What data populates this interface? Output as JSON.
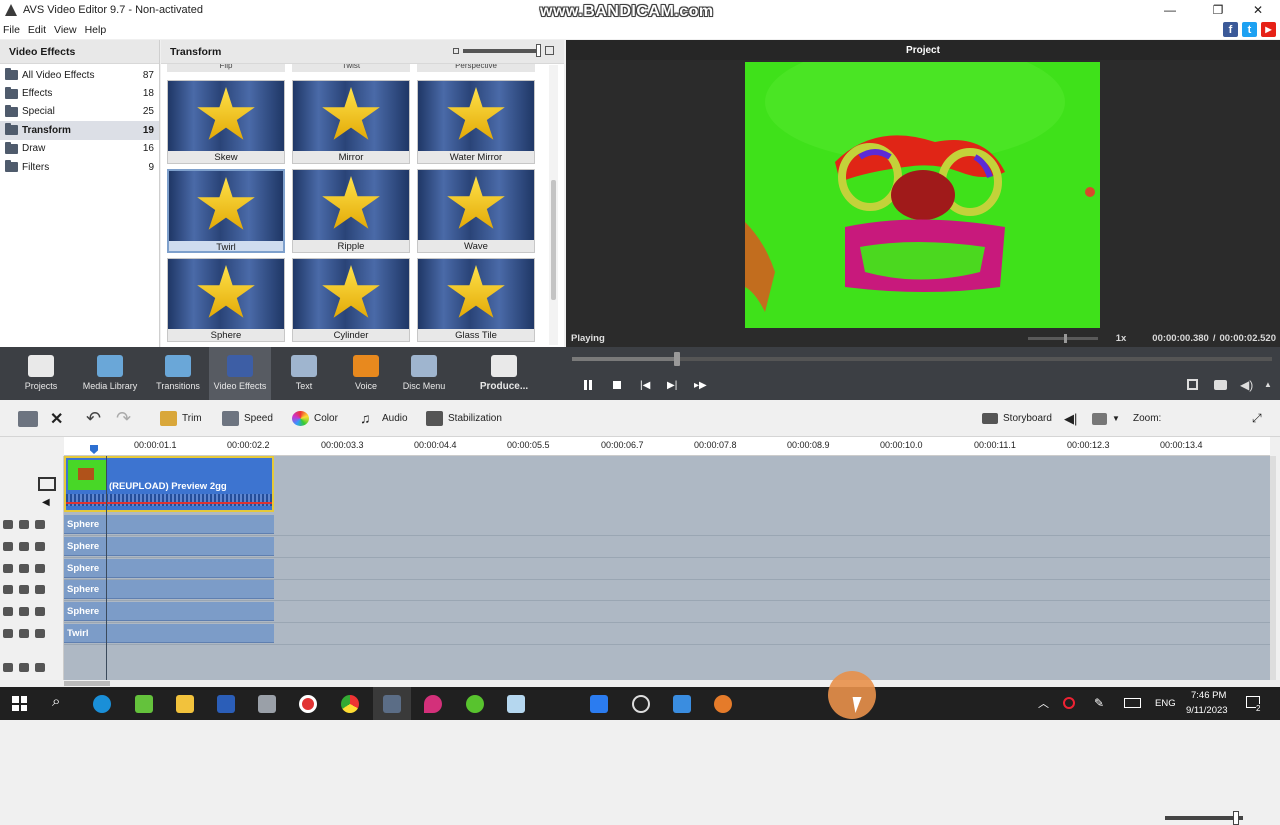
{
  "window": {
    "title": "AVS Video Editor 9.7 - Non-activated",
    "watermark": "www.BANDICAM.com",
    "controls": [
      "—",
      "❐",
      "✕"
    ]
  },
  "menu": [
    "File",
    "Edit",
    "View",
    "Help"
  ],
  "social": [
    {
      "label": "f",
      "color": "#3b5998"
    },
    {
      "label": "t",
      "color": "#1da1f2"
    },
    {
      "label": "▶",
      "color": "#e62117"
    }
  ],
  "categories": {
    "header": "Video Effects",
    "items": [
      {
        "label": "All Video Effects",
        "count": "87"
      },
      {
        "label": "Effects",
        "count": "18"
      },
      {
        "label": "Special",
        "count": "25"
      },
      {
        "label": "Transform",
        "count": "19"
      },
      {
        "label": "Draw",
        "count": "16"
      },
      {
        "label": "Filters",
        "count": "9"
      }
    ]
  },
  "effects": {
    "header": "Transform",
    "top_partial": [
      "Flip",
      "Twist",
      "Perspective"
    ],
    "items": [
      {
        "label": "Skew"
      },
      {
        "label": "Mirror"
      },
      {
        "label": "Water Mirror"
      },
      {
        "label": "Twirl"
      },
      {
        "label": "Ripple"
      },
      {
        "label": "Wave"
      },
      {
        "label": "Sphere"
      },
      {
        "label": "Cylinder"
      },
      {
        "label": "Glass Tile"
      }
    ]
  },
  "preview": {
    "header": "Project",
    "status": "Playing",
    "speed": "1x",
    "time_current": "00:00:00.380",
    "time_separator": "/",
    "time_total": "00:00:02.520",
    "progress_fraction": 0.15
  },
  "bigbar": [
    {
      "label": "Projects",
      "color": "#e9e9e9"
    },
    {
      "label": "Media Library",
      "color": "#6aa7d8"
    },
    {
      "label": "Transitions",
      "color": "#6aa7d8"
    },
    {
      "label": "Video Effects",
      "color": "#3d5ea5"
    },
    {
      "label": "Text",
      "color": "#9fb5cf"
    },
    {
      "label": "Voice",
      "color": "#e8891e"
    },
    {
      "label": "Disc Menu",
      "color": "#9fb5cf"
    },
    {
      "label": "Produce...",
      "color": "#e9e9e9"
    }
  ],
  "edit_tools": {
    "trim": "Trim",
    "speed": "Speed",
    "color": "Color",
    "audio": "Audio",
    "stabilization": "Stabilization",
    "storyboard": "Storyboard",
    "zoom": "Zoom:"
  },
  "ruler": [
    "00:00:01.1",
    "00:00:02.2",
    "00:00:03.3",
    "00:00:04.4",
    "00:00:05.5",
    "00:00:06.7",
    "00:00:07.8",
    "00:00:08.9",
    "00:00:10.0",
    "00:00:11.1",
    "00:00:12.3",
    "00:00:13.4"
  ],
  "timeline": {
    "video_clip": "(REUPLOAD) Preview 2gg",
    "fx_tracks": [
      "Sphere",
      "Sphere",
      "Sphere",
      "Sphere",
      "Sphere",
      "Twirl"
    ]
  },
  "taskbar": {
    "lang": "ENG",
    "time": "7:46 PM",
    "date": "9/11/2023",
    "notif_count": "2"
  }
}
